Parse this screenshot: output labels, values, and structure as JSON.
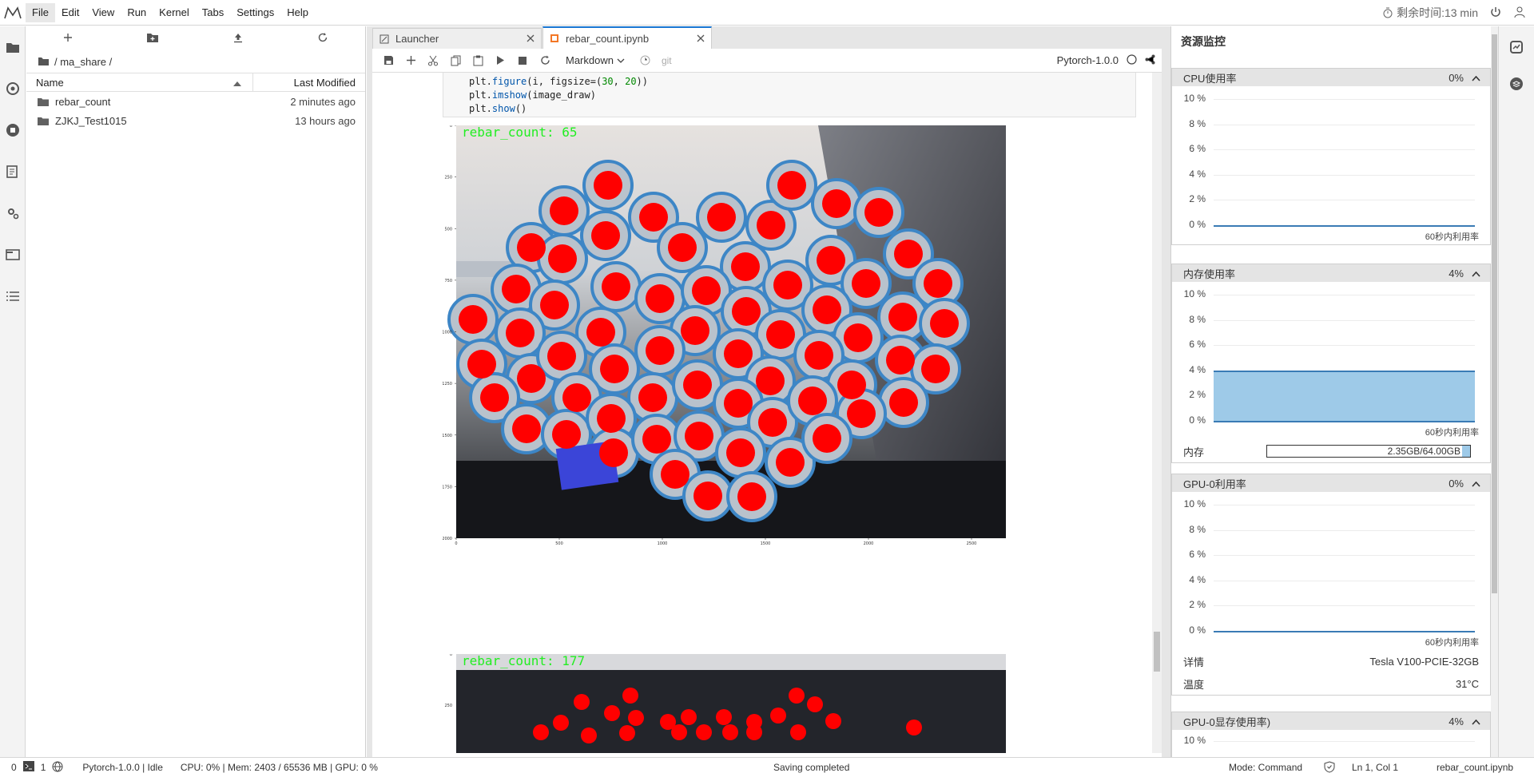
{
  "menu": {
    "items": [
      "File",
      "Edit",
      "View",
      "Run",
      "Kernel",
      "Tabs",
      "Settings",
      "Help"
    ],
    "timer": "剩余时间:13 min"
  },
  "filebrowser": {
    "breadcrumb": "/ ma_share /",
    "col_name": "Name",
    "col_modified": "Last Modified",
    "rows": [
      {
        "name": "rebar_count",
        "modified": "2 minutes ago"
      },
      {
        "name": "ZJKJ_Test1015",
        "modified": "13 hours ago"
      }
    ]
  },
  "tabs": [
    {
      "label": "Launcher"
    },
    {
      "label": "rebar_count.ipynb"
    }
  ],
  "notebook": {
    "cell_type": "Markdown",
    "git": "git",
    "kernel": "Pytorch-1.0.0",
    "code_lines": [
      "plt.figure(i, figsize=(30, 20))",
      "plt.imshow(image_draw)",
      "plt.show()"
    ],
    "plot1_label": "rebar_count: 65",
    "plot2_label": "rebar_count: 177",
    "plot1_yticks": [
      "0",
      "250",
      "500",
      "750",
      "1000",
      "1250",
      "1500",
      "1750",
      "2000"
    ],
    "plot1_xticks": [
      "0",
      "500",
      "1000",
      "1500",
      "2000",
      "2500"
    ],
    "plot2_yticks": [
      "0",
      "250"
    ]
  },
  "monitor": {
    "title": "资源监控",
    "cpu": {
      "title": "CPU使用率",
      "value": "0%",
      "level": 0
    },
    "mem": {
      "title": "内存使用率",
      "value": "4%",
      "level": 4,
      "label": "内存",
      "usage": "2.35GB/64.00GB"
    },
    "gpu": {
      "title": "GPU-0利用率",
      "value": "0%",
      "level": 0,
      "detail_k": "详情",
      "detail_v": "Tesla V100-PCIE-32GB",
      "temp_k": "温度",
      "temp_v": "31°C"
    },
    "gpumem": {
      "title": "GPU-0显存使用率)",
      "value": "4%"
    },
    "yticks": [
      "10 %",
      "8 %",
      "6 %",
      "4 %",
      "2 %",
      "0 %"
    ],
    "window_note": "60秒内利用率",
    "gpumem_tick": "10 %"
  },
  "status": {
    "terminals": "0",
    "kernels": "1",
    "kernel_state": "Pytorch-1.0.0 | Idle",
    "resources": "CPU: 0% | Mem: 2403 / 65536 MB | GPU: 0 %",
    "message": "Saving completed",
    "mode": "Mode: Command",
    "cursor": "Ln 1, Col 1",
    "file": "rebar_count.ipynb"
  },
  "colors": {
    "accent": "#1976d2",
    "detection": "#ff0000",
    "label_green": "#22ee22",
    "mem_fill": "#9ecae8"
  }
}
